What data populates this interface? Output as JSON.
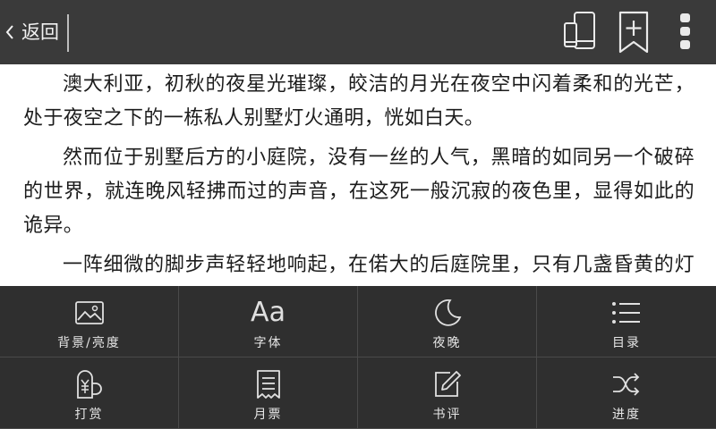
{
  "topbar": {
    "back_label": "返回",
    "icons": [
      "chevron-left-icon",
      "phone-tablet-icon",
      "add-bookmark-icon",
      "more-vertical-icon"
    ]
  },
  "content": {
    "paragraphs": [
      "澳大利亚，初秋的夜星光璀璨，皎洁的月光在夜空中闪着柔和的光芒，处于夜空之下的一栋私人别墅灯火通明，恍如白天。",
      "然而位于别墅后方的小庭院，没有一丝的人气，黑暗的如同另一个破碎的世界，就连晚风轻拂而过的声音，在这死一般沉寂的夜色里，显得如此的诡异。",
      "一阵细微的脚步声轻轻地响起，在偌大的后庭院里，只有几盏昏黄的灯光在四周亮着，显得有些微弱的光芒。"
    ]
  },
  "menu": {
    "items": [
      {
        "label": "背景/亮度",
        "icon": "image-icon"
      },
      {
        "label": "字体",
        "icon": "font-icon",
        "glyph": "Aa"
      },
      {
        "label": "夜晚",
        "icon": "moon-icon"
      },
      {
        "label": "目录",
        "icon": "list-icon"
      },
      {
        "label": "打赏",
        "icon": "reward-icon"
      },
      {
        "label": "月票",
        "icon": "ticket-icon"
      },
      {
        "label": "书评",
        "icon": "edit-icon"
      },
      {
        "label": "进度",
        "icon": "shuffle-icon"
      }
    ]
  },
  "colors": {
    "topbar_bg": "#3a3a3a",
    "menu_bg": "#2f2f2f",
    "text": "#1c1c1c",
    "page_bg": "#ffffff"
  }
}
